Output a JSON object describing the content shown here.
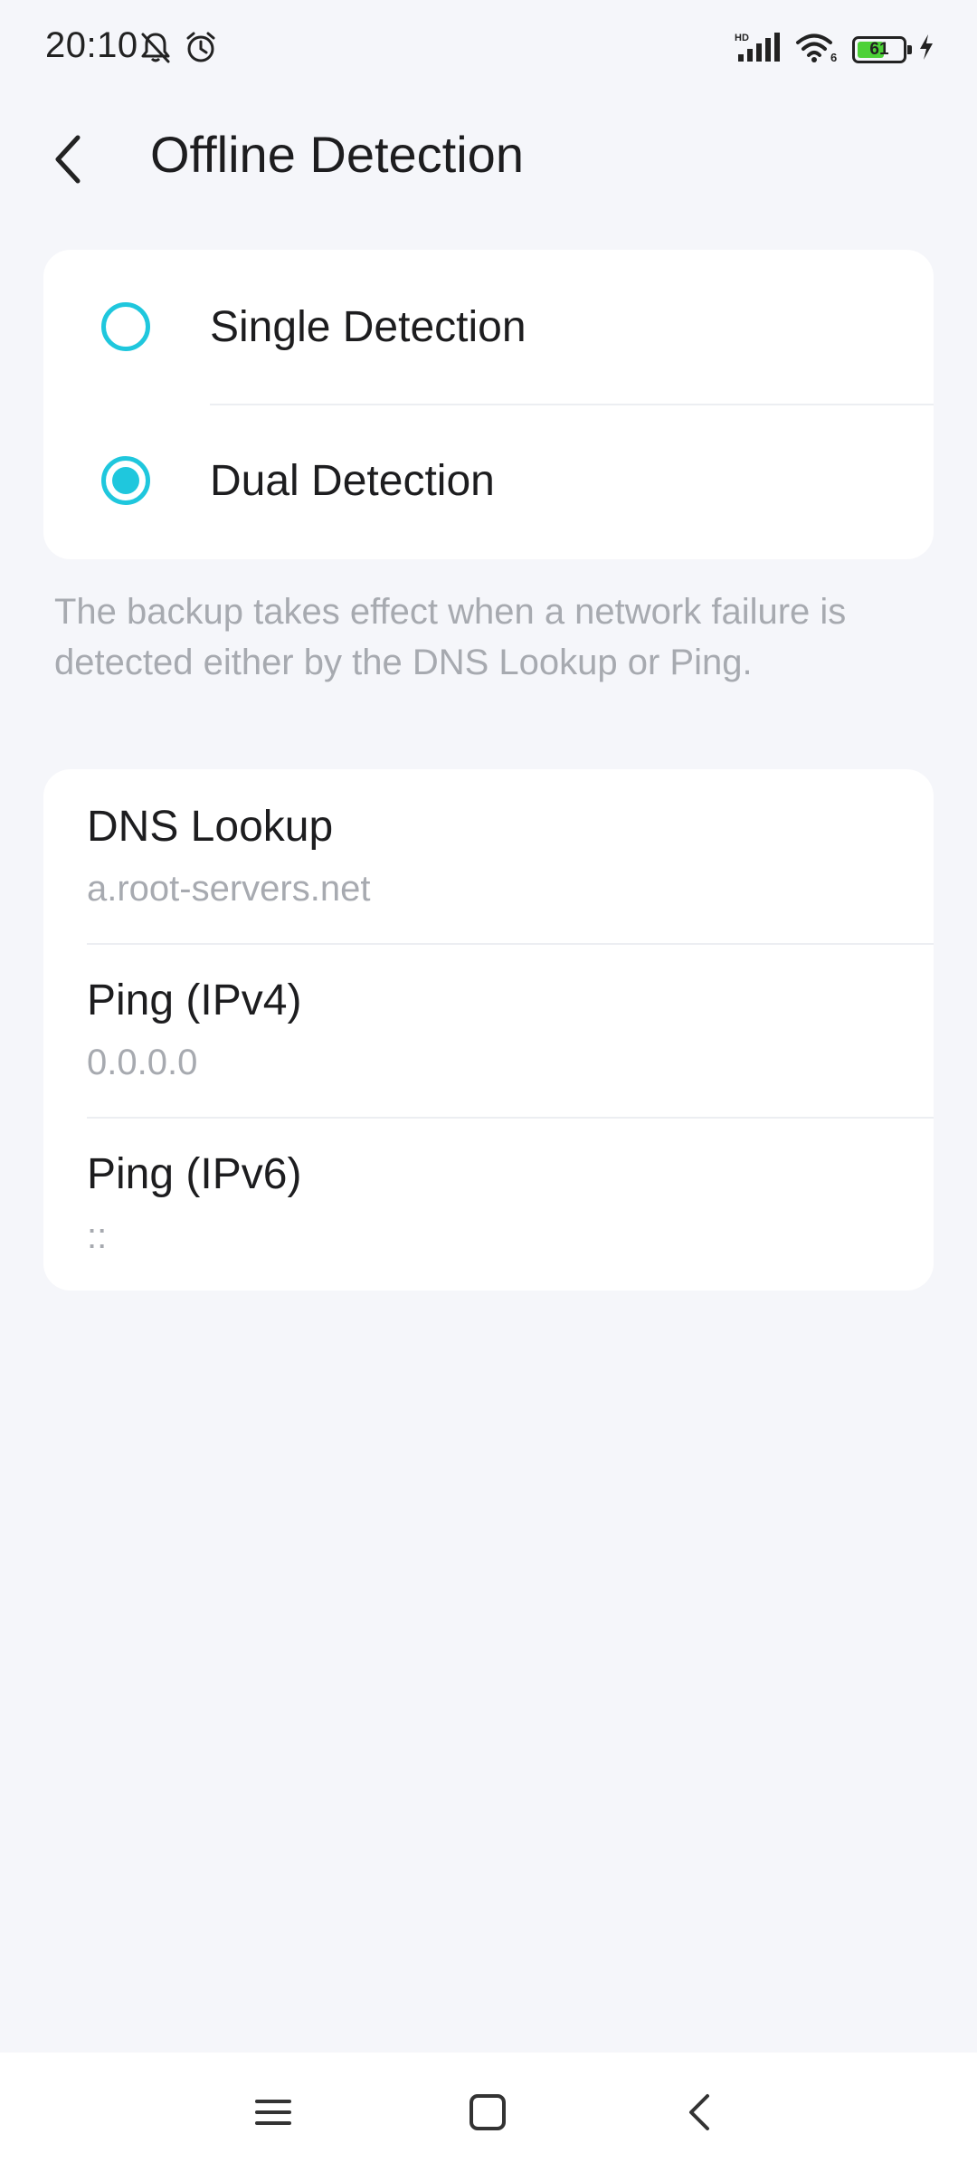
{
  "status_bar": {
    "time": "20:10",
    "battery_level": "61",
    "battery_percent": 61,
    "icons": [
      "bell-muted-icon",
      "alarm-icon",
      "signal-hd-icon",
      "wifi-6-icon",
      "battery-icon",
      "charging-icon"
    ]
  },
  "header": {
    "title": "Offline Detection",
    "back_icon": "chevron-left-icon"
  },
  "detection_options": {
    "items": [
      {
        "label": "Single Detection",
        "selected": false
      },
      {
        "label": "Dual Detection",
        "selected": true
      }
    ],
    "description": "The backup takes effect when a network failure is detected either by the DNS Lookup or Ping."
  },
  "targets": {
    "items": [
      {
        "label": "DNS Lookup",
        "value": "a.root-servers.net"
      },
      {
        "label": "Ping (IPv4)",
        "value": "0.0.0.0"
      },
      {
        "label": "Ping (IPv6)",
        "value": "::"
      }
    ]
  },
  "nav_bar": {
    "icons": [
      "menu-icon",
      "home-square-icon",
      "back-icon"
    ]
  },
  "colors": {
    "accent": "#1fc7dd",
    "background": "#f5f6fa",
    "card": "#ffffff",
    "secondary_text": "#a7aab0",
    "battery_fill": "#4cd137"
  }
}
